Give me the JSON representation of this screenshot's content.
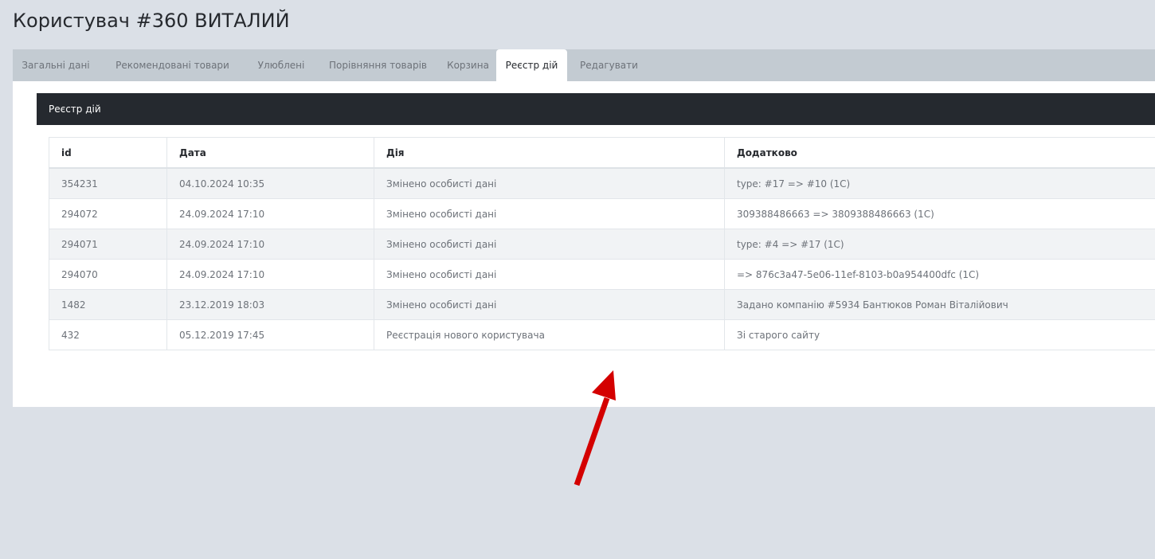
{
  "page": {
    "title": "Користувач #360 ВИТАЛИЙ"
  },
  "tabs": [
    {
      "label": "Загальні дані"
    },
    {
      "label": "Рекомендовані товари"
    },
    {
      "label": "Улюблені"
    },
    {
      "label": "Порівняння товарів"
    },
    {
      "label": "Корзина"
    },
    {
      "label": "Реєстр дій"
    },
    {
      "label": "Редагувати"
    }
  ],
  "active_tab": "Реєстр дій",
  "section": {
    "title": "Реєстр дій"
  },
  "table": {
    "columns": [
      "id",
      "Дата",
      "Дія",
      "Додатково"
    ],
    "rows": [
      {
        "id": "354231",
        "date": "04.10.2024 10:35",
        "action": "Змінено особисті дані",
        "extra": "type: #17 => #10 (1С)"
      },
      {
        "id": "294072",
        "date": "24.09.2024 17:10",
        "action": "Змінено особисті дані",
        "extra": "309388486663 => 3809388486663 (1С)"
      },
      {
        "id": "294071",
        "date": "24.09.2024 17:10",
        "action": "Змінено особисті дані",
        "extra": "type: #4 => #17 (1С)"
      },
      {
        "id": "294070",
        "date": "24.09.2024 17:10",
        "action": "Змінено особисті дані",
        "extra": "=> 876c3a47-5e06-11ef-8103-b0a954400dfc (1С)"
      },
      {
        "id": "1482",
        "date": "23.12.2019 18:03",
        "action": "Змінено особисті дані",
        "extra": "Задано компанію #5934 Бантюков Роман Віталійович"
      },
      {
        "id": "432",
        "date": "05.12.2019 17:45",
        "action": "Реєстрація нового користувача",
        "extra": "Зі старого сайту"
      }
    ]
  },
  "colors": {
    "page_bg": "#dbe0e7",
    "tabbar_bg": "#c3cbd2",
    "section_bar_bg": "#25292f",
    "stripe_bg": "#f1f3f5",
    "annotation_arrow": "#d40000"
  }
}
